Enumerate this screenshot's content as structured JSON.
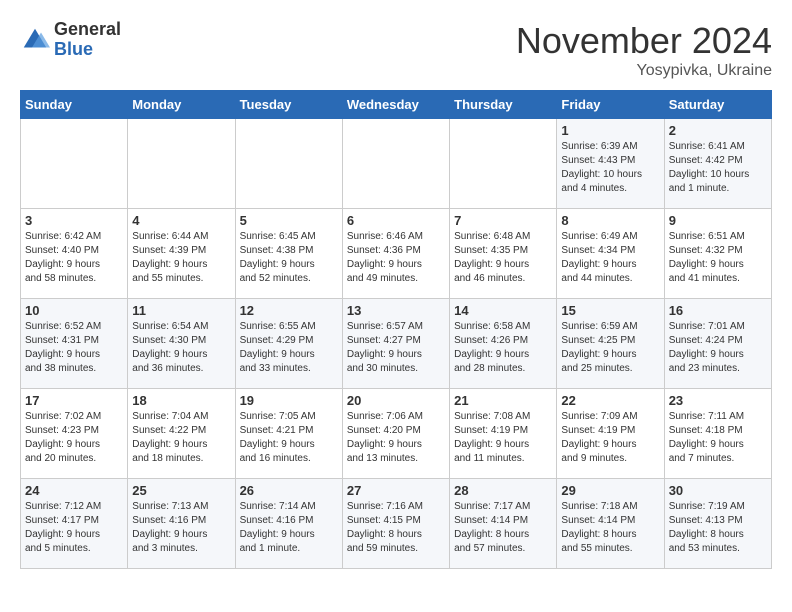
{
  "logo": {
    "general": "General",
    "blue": "Blue"
  },
  "header": {
    "month": "November 2024",
    "location": "Yosypivka, Ukraine"
  },
  "weekdays": [
    "Sunday",
    "Monday",
    "Tuesday",
    "Wednesday",
    "Thursday",
    "Friday",
    "Saturday"
  ],
  "weeks": [
    [
      {
        "day": "",
        "info": ""
      },
      {
        "day": "",
        "info": ""
      },
      {
        "day": "",
        "info": ""
      },
      {
        "day": "",
        "info": ""
      },
      {
        "day": "",
        "info": ""
      },
      {
        "day": "1",
        "info": "Sunrise: 6:39 AM\nSunset: 4:43 PM\nDaylight: 10 hours\nand 4 minutes."
      },
      {
        "day": "2",
        "info": "Sunrise: 6:41 AM\nSunset: 4:42 PM\nDaylight: 10 hours\nand 1 minute."
      }
    ],
    [
      {
        "day": "3",
        "info": "Sunrise: 6:42 AM\nSunset: 4:40 PM\nDaylight: 9 hours\nand 58 minutes."
      },
      {
        "day": "4",
        "info": "Sunrise: 6:44 AM\nSunset: 4:39 PM\nDaylight: 9 hours\nand 55 minutes."
      },
      {
        "day": "5",
        "info": "Sunrise: 6:45 AM\nSunset: 4:38 PM\nDaylight: 9 hours\nand 52 minutes."
      },
      {
        "day": "6",
        "info": "Sunrise: 6:46 AM\nSunset: 4:36 PM\nDaylight: 9 hours\nand 49 minutes."
      },
      {
        "day": "7",
        "info": "Sunrise: 6:48 AM\nSunset: 4:35 PM\nDaylight: 9 hours\nand 46 minutes."
      },
      {
        "day": "8",
        "info": "Sunrise: 6:49 AM\nSunset: 4:34 PM\nDaylight: 9 hours\nand 44 minutes."
      },
      {
        "day": "9",
        "info": "Sunrise: 6:51 AM\nSunset: 4:32 PM\nDaylight: 9 hours\nand 41 minutes."
      }
    ],
    [
      {
        "day": "10",
        "info": "Sunrise: 6:52 AM\nSunset: 4:31 PM\nDaylight: 9 hours\nand 38 minutes."
      },
      {
        "day": "11",
        "info": "Sunrise: 6:54 AM\nSunset: 4:30 PM\nDaylight: 9 hours\nand 36 minutes."
      },
      {
        "day": "12",
        "info": "Sunrise: 6:55 AM\nSunset: 4:29 PM\nDaylight: 9 hours\nand 33 minutes."
      },
      {
        "day": "13",
        "info": "Sunrise: 6:57 AM\nSunset: 4:27 PM\nDaylight: 9 hours\nand 30 minutes."
      },
      {
        "day": "14",
        "info": "Sunrise: 6:58 AM\nSunset: 4:26 PM\nDaylight: 9 hours\nand 28 minutes."
      },
      {
        "day": "15",
        "info": "Sunrise: 6:59 AM\nSunset: 4:25 PM\nDaylight: 9 hours\nand 25 minutes."
      },
      {
        "day": "16",
        "info": "Sunrise: 7:01 AM\nSunset: 4:24 PM\nDaylight: 9 hours\nand 23 minutes."
      }
    ],
    [
      {
        "day": "17",
        "info": "Sunrise: 7:02 AM\nSunset: 4:23 PM\nDaylight: 9 hours\nand 20 minutes."
      },
      {
        "day": "18",
        "info": "Sunrise: 7:04 AM\nSunset: 4:22 PM\nDaylight: 9 hours\nand 18 minutes."
      },
      {
        "day": "19",
        "info": "Sunrise: 7:05 AM\nSunset: 4:21 PM\nDaylight: 9 hours\nand 16 minutes."
      },
      {
        "day": "20",
        "info": "Sunrise: 7:06 AM\nSunset: 4:20 PM\nDaylight: 9 hours\nand 13 minutes."
      },
      {
        "day": "21",
        "info": "Sunrise: 7:08 AM\nSunset: 4:19 PM\nDaylight: 9 hours\nand 11 minutes."
      },
      {
        "day": "22",
        "info": "Sunrise: 7:09 AM\nSunset: 4:19 PM\nDaylight: 9 hours\nand 9 minutes."
      },
      {
        "day": "23",
        "info": "Sunrise: 7:11 AM\nSunset: 4:18 PM\nDaylight: 9 hours\nand 7 minutes."
      }
    ],
    [
      {
        "day": "24",
        "info": "Sunrise: 7:12 AM\nSunset: 4:17 PM\nDaylight: 9 hours\nand 5 minutes."
      },
      {
        "day": "25",
        "info": "Sunrise: 7:13 AM\nSunset: 4:16 PM\nDaylight: 9 hours\nand 3 minutes."
      },
      {
        "day": "26",
        "info": "Sunrise: 7:14 AM\nSunset: 4:16 PM\nDaylight: 9 hours\nand 1 minute."
      },
      {
        "day": "27",
        "info": "Sunrise: 7:16 AM\nSunset: 4:15 PM\nDaylight: 8 hours\nand 59 minutes."
      },
      {
        "day": "28",
        "info": "Sunrise: 7:17 AM\nSunset: 4:14 PM\nDaylight: 8 hours\nand 57 minutes."
      },
      {
        "day": "29",
        "info": "Sunrise: 7:18 AM\nSunset: 4:14 PM\nDaylight: 8 hours\nand 55 minutes."
      },
      {
        "day": "30",
        "info": "Sunrise: 7:19 AM\nSunset: 4:13 PM\nDaylight: 8 hours\nand 53 minutes."
      }
    ]
  ]
}
